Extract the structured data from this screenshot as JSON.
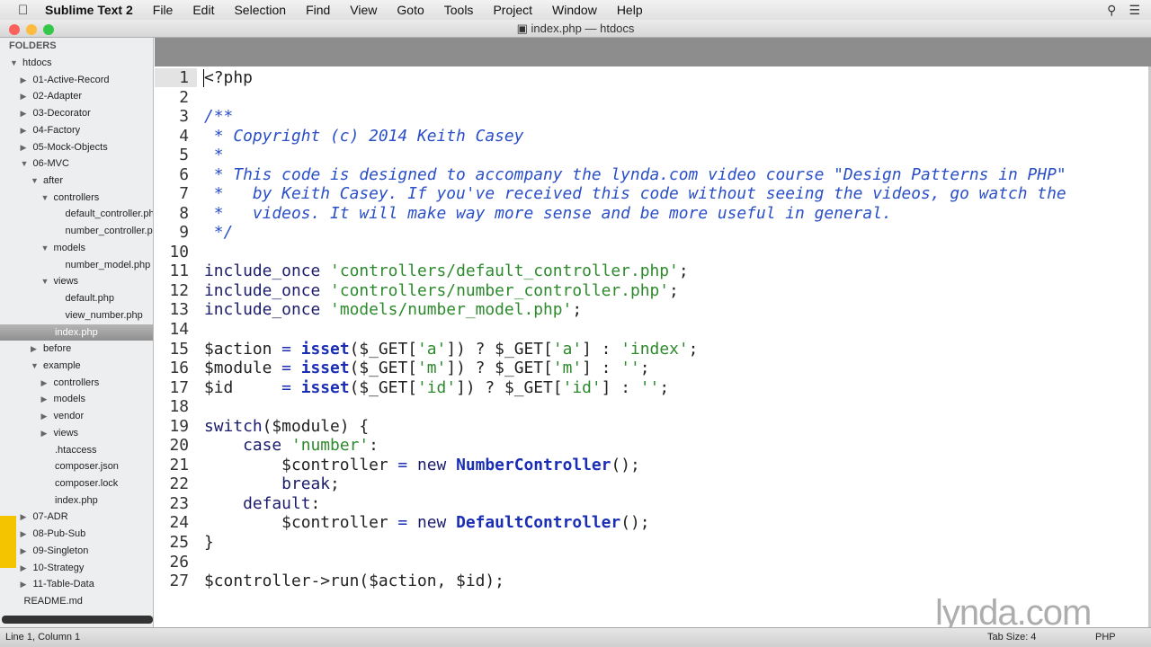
{
  "menubar": {
    "app": "Sublime Text 2",
    "items": [
      "File",
      "Edit",
      "Selection",
      "Find",
      "View",
      "Goto",
      "Tools",
      "Project",
      "Window",
      "Help"
    ]
  },
  "window": {
    "title": "index.php — htdocs"
  },
  "sidebar": {
    "header": "FOLDERS",
    "items": [
      {
        "label": "htdocs",
        "depth": 0,
        "arrow": "open"
      },
      {
        "label": "01-Active-Record",
        "depth": 1,
        "arrow": "closed"
      },
      {
        "label": "02-Adapter",
        "depth": 1,
        "arrow": "closed"
      },
      {
        "label": "03-Decorator",
        "depth": 1,
        "arrow": "closed"
      },
      {
        "label": "04-Factory",
        "depth": 1,
        "arrow": "closed"
      },
      {
        "label": "05-Mock-Objects",
        "depth": 1,
        "arrow": "closed"
      },
      {
        "label": "06-MVC",
        "depth": 1,
        "arrow": "open"
      },
      {
        "label": "after",
        "depth": 2,
        "arrow": "open"
      },
      {
        "label": "controllers",
        "depth": 3,
        "arrow": "open"
      },
      {
        "label": "default_controller.php",
        "depth": 5,
        "arrow": ""
      },
      {
        "label": "number_controller.php",
        "depth": 5,
        "arrow": ""
      },
      {
        "label": "models",
        "depth": 3,
        "arrow": "open"
      },
      {
        "label": "number_model.php",
        "depth": 5,
        "arrow": ""
      },
      {
        "label": "views",
        "depth": 3,
        "arrow": "open"
      },
      {
        "label": "default.php",
        "depth": 5,
        "arrow": ""
      },
      {
        "label": "view_number.php",
        "depth": 5,
        "arrow": ""
      },
      {
        "label": "index.php",
        "depth": 4,
        "arrow": "",
        "selected": true
      },
      {
        "label": "before",
        "depth": 2,
        "arrow": "closed"
      },
      {
        "label": "example",
        "depth": 2,
        "arrow": "open"
      },
      {
        "label": "controllers",
        "depth": 3,
        "arrow": "closed"
      },
      {
        "label": "models",
        "depth": 3,
        "arrow": "closed"
      },
      {
        "label": "vendor",
        "depth": 3,
        "arrow": "closed"
      },
      {
        "label": "views",
        "depth": 3,
        "arrow": "closed"
      },
      {
        "label": ".htaccess",
        "depth": 4,
        "arrow": ""
      },
      {
        "label": "composer.json",
        "depth": 4,
        "arrow": ""
      },
      {
        "label": "composer.lock",
        "depth": 4,
        "arrow": ""
      },
      {
        "label": "index.php",
        "depth": 4,
        "arrow": ""
      },
      {
        "label": "07-ADR",
        "depth": 1,
        "arrow": "closed"
      },
      {
        "label": "08-Pub-Sub",
        "depth": 1,
        "arrow": "closed"
      },
      {
        "label": "09-Singleton",
        "depth": 1,
        "arrow": "closed"
      },
      {
        "label": "10-Strategy",
        "depth": 1,
        "arrow": "closed"
      },
      {
        "label": "11-Table-Data",
        "depth": 1,
        "arrow": "closed"
      },
      {
        "label": "README.md",
        "depth": 1,
        "arrow": ""
      }
    ]
  },
  "code": [
    [
      [
        "",
        "<?php"
      ]
    ],
    [],
    [
      [
        "cm",
        "/**"
      ]
    ],
    [
      [
        "cm",
        " * Copyright (c) 2014 Keith Casey"
      ]
    ],
    [
      [
        "cm",
        " *"
      ]
    ],
    [
      [
        "cm",
        " * This code is designed to accompany the lynda.com video course \"Design Patterns in PHP\""
      ]
    ],
    [
      [
        "cm",
        " *   by Keith Casey. If you've received this code without seeing the videos, go watch the"
      ]
    ],
    [
      [
        "cm",
        " *   videos. It will make way more sense and be more useful in general."
      ]
    ],
    [
      [
        "cm",
        " */"
      ]
    ],
    [],
    [
      [
        "kw",
        "include_once"
      ],
      [
        "",
        " "
      ],
      [
        "st",
        "'controllers/default_controller.php'"
      ],
      [
        "",
        ";"
      ]
    ],
    [
      [
        "kw",
        "include_once"
      ],
      [
        "",
        " "
      ],
      [
        "st",
        "'controllers/number_controller.php'"
      ],
      [
        "",
        ";"
      ]
    ],
    [
      [
        "kw",
        "include_once"
      ],
      [
        "",
        " "
      ],
      [
        "st",
        "'models/number_model.php'"
      ],
      [
        "",
        ";"
      ]
    ],
    [],
    [
      [
        "",
        "$action "
      ],
      [
        "op",
        "="
      ],
      [
        "",
        " "
      ],
      [
        "fn",
        "isset"
      ],
      [
        "",
        "($_GET["
      ],
      [
        "st",
        "'a'"
      ],
      [
        "",
        "]) ? $_GET["
      ],
      [
        "st",
        "'a'"
      ],
      [
        "",
        "] : "
      ],
      [
        "st",
        "'index'"
      ],
      [
        "",
        ";"
      ]
    ],
    [
      [
        "",
        "$module "
      ],
      [
        "op",
        "="
      ],
      [
        "",
        " "
      ],
      [
        "fn",
        "isset"
      ],
      [
        "",
        "($_GET["
      ],
      [
        "st",
        "'m'"
      ],
      [
        "",
        "]) ? $_GET["
      ],
      [
        "st",
        "'m'"
      ],
      [
        "",
        "] : "
      ],
      [
        "st",
        "''"
      ],
      [
        "",
        ";"
      ]
    ],
    [
      [
        "",
        "$id     "
      ],
      [
        "op",
        "="
      ],
      [
        "",
        " "
      ],
      [
        "fn",
        "isset"
      ],
      [
        "",
        "($_GET["
      ],
      [
        "st",
        "'id'"
      ],
      [
        "",
        "]) ? $_GET["
      ],
      [
        "st",
        "'id'"
      ],
      [
        "",
        "] : "
      ],
      [
        "st",
        "''"
      ],
      [
        "",
        ";"
      ]
    ],
    [],
    [
      [
        "kw",
        "switch"
      ],
      [
        "",
        "($module) {"
      ]
    ],
    [
      [
        "",
        "    "
      ],
      [
        "kw",
        "case"
      ],
      [
        "",
        " "
      ],
      [
        "st",
        "'number'"
      ],
      [
        "",
        ":"
      ]
    ],
    [
      [
        "",
        "        $controller "
      ],
      [
        "op",
        "="
      ],
      [
        "",
        " "
      ],
      [
        "kw",
        "new"
      ],
      [
        "",
        " "
      ],
      [
        "fn",
        "NumberController"
      ],
      [
        "",
        "();"
      ]
    ],
    [
      [
        "",
        "        "
      ],
      [
        "kw",
        "break"
      ],
      [
        "",
        ";"
      ]
    ],
    [
      [
        "",
        "    "
      ],
      [
        "kw",
        "default"
      ],
      [
        "",
        ":"
      ]
    ],
    [
      [
        "",
        "        $controller "
      ],
      [
        "op",
        "="
      ],
      [
        "",
        " "
      ],
      [
        "kw",
        "new"
      ],
      [
        "",
        " "
      ],
      [
        "fn",
        "DefaultController"
      ],
      [
        "",
        "();"
      ]
    ],
    [
      [
        "",
        "}"
      ]
    ],
    [],
    [
      [
        "",
        "$controller->run($action, $id);"
      ]
    ]
  ],
  "status": {
    "position": "Line 1, Column 1",
    "tab_size": "Tab Size: 4",
    "syntax": "PHP"
  },
  "watermark": "lynda.com"
}
